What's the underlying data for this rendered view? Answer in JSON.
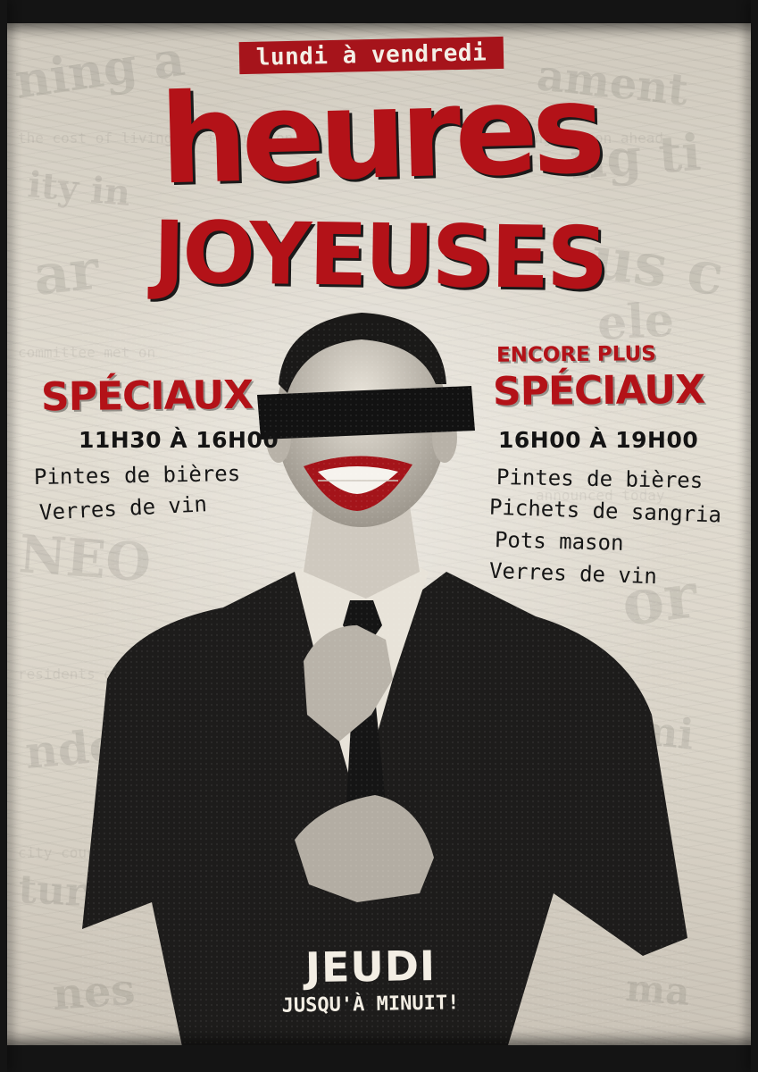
{
  "banner": {
    "days": "lundi à vendredi"
  },
  "title": {
    "line1": "heures",
    "line2": "JOYEUSES"
  },
  "left_column": {
    "heading": "SPÉCIAUX",
    "hours": "11H30 À 16H00",
    "items": [
      "Pintes de bières",
      "Verres de vin"
    ]
  },
  "right_column": {
    "kicker": "ENCORE PLUS",
    "heading": "SPÉCIAUX",
    "hours": "16H00 À 19H00",
    "items": [
      "Pintes de bières",
      "Pichets de sangria",
      "Pots mason",
      "Verres de vin"
    ]
  },
  "footer": {
    "day": "JEUDI",
    "note": "JUSQU'À MINUIT!"
  },
  "colors": {
    "accent_red": "#b31218",
    "ink": "#141414",
    "paper": "#ddd7cb"
  }
}
